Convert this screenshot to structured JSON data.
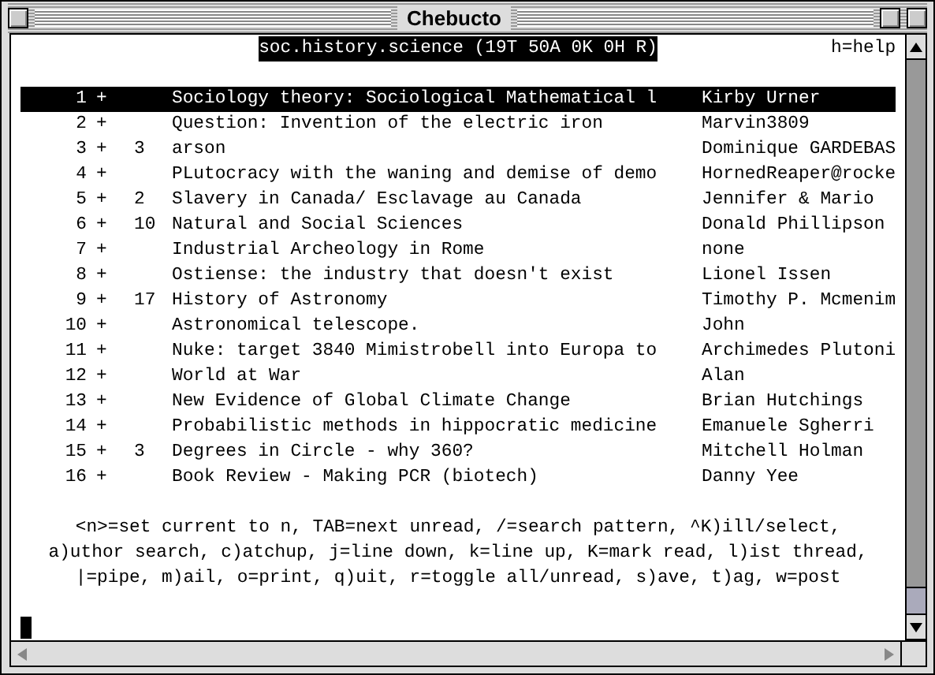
{
  "window": {
    "title": "Chebucto"
  },
  "header": {
    "group": "soc.history.science (19T 50A 0K 0H R)",
    "help": "h=help"
  },
  "threads": [
    {
      "number": "1",
      "marker": "+",
      "subject": "Sociology theory: Sociological Mathematical l",
      "author": "Kirby Urner",
      "selected": true
    },
    {
      "number": "2",
      "marker": "+",
      "subject": "Question: Invention of the electric iron",
      "author": "Marvin3809",
      "selected": false
    },
    {
      "number": "3",
      "marker": "+",
      "count": "3",
      "subject": "arson",
      "author": "Dominique GARDEBAS",
      "selected": false
    },
    {
      "number": "4",
      "marker": "+",
      "subject": "PLutocracy with the waning and demise of demo",
      "author": "HornedReaper@rocke",
      "selected": false
    },
    {
      "number": "5",
      "marker": "+",
      "count": "2",
      "subject": "Slavery in Canada/ Esclavage au Canada",
      "author": "Jennifer & Mario",
      "selected": false
    },
    {
      "number": "6",
      "marker": "+",
      "count": "10",
      "subject": "Natural and Social Sciences",
      "author": "Donald Phillipson",
      "selected": false
    },
    {
      "number": "7",
      "marker": "+",
      "subject": "Industrial Archeology in Rome",
      "author": "none",
      "selected": false
    },
    {
      "number": "8",
      "marker": "+",
      "subject": "Ostiense: the industry that doesn't exist",
      "author": "Lionel Issen",
      "selected": false
    },
    {
      "number": "9",
      "marker": "+",
      "count": "17",
      "subject": "History of Astronomy",
      "author": "Timothy P. Mcmenim",
      "selected": false
    },
    {
      "number": "10",
      "marker": "+",
      "subject": "Astronomical telescope.",
      "author": "John",
      "selected": false
    },
    {
      "number": "11",
      "marker": "+",
      "subject": "Nuke: target 3840 Mimistrobell into Europa to",
      "author": "Archimedes Plutoni",
      "selected": false
    },
    {
      "number": "12",
      "marker": "+",
      "subject": "World at War",
      "author": "Alan",
      "selected": false
    },
    {
      "number": "13",
      "marker": "+",
      "subject": "New Evidence of Global Climate Change",
      "author": "Brian Hutchings",
      "selected": false
    },
    {
      "number": "14",
      "marker": "+",
      "subject": "Probabilistic methods in hippocratic medicine",
      "author": "Emanuele Sgherri",
      "selected": false
    },
    {
      "number": "15",
      "marker": "+",
      "count": "3",
      "subject": "Degrees in Circle - why 360?",
      "author": "Mitchell Holman",
      "selected": false
    },
    {
      "number": "16",
      "marker": "+",
      "subject": "Book Review - Making PCR (biotech)",
      "author": "Danny Yee",
      "selected": false
    }
  ],
  "help_lines": [
    "<n>=set current to n, TAB=next unread, /=search pattern, ^K)ill/select,",
    "a)uthor search, c)atchup, j=line down, k=line up, K=mark read, l)ist thread,",
    "|=pipe, m)ail, o=print, q)uit, r=toggle all/unread, s)ave, t)ag, w=post"
  ]
}
